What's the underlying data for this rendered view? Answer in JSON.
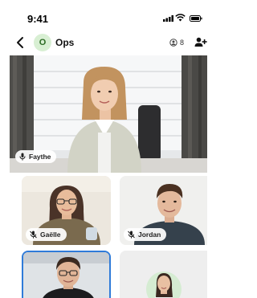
{
  "status_bar": {
    "time": "9:41",
    "signal_icon": "signal-icon",
    "wifi_icon": "wifi-icon",
    "battery_icon": "battery-icon"
  },
  "header": {
    "back_icon": "chevron-left-icon",
    "team_initial": "O",
    "team_name": "Ops",
    "participant_count": "8",
    "add_participant_icon": "add-user-icon"
  },
  "main_video": {
    "name": "Faythe",
    "icon": "microphone-icon"
  },
  "grid": [
    {
      "name": "Gaëlle",
      "icon": "mic-off-icon"
    },
    {
      "name": "Jordan",
      "icon": "mic-off-icon"
    }
  ],
  "colors": {
    "accent": "#2b6a23",
    "active_border": "#2f7bd9",
    "avatar_bg": "#d8efd3"
  }
}
